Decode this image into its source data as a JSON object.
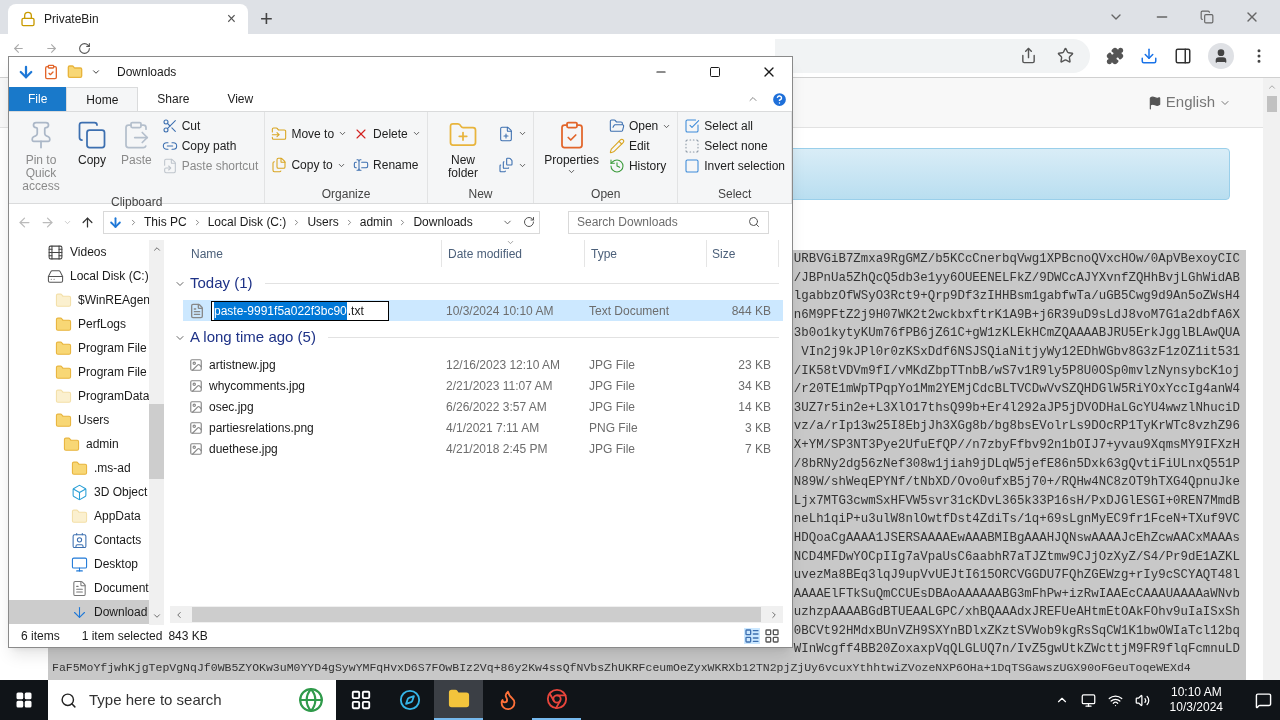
{
  "browser": {
    "tab": {
      "title": "PrivateBin",
      "close": "×"
    },
    "new_tab": "+",
    "language": "English"
  },
  "page": {
    "code_lines": [
      "URBVGiB7Zmxa9RgGMZ/b5KCcCnerbqVwg1XPBcnoQVxcHOw/0ApVBexoyCIC",
      "/JBPnUa5ZhQcQ5db3e1yy6OUEENELFkZ/9DWCcAJYXvnfZQHhBvjLGhWidAB",
      "lgabbzOfWSyO3Rct9+Qrp9Df3zIHHBsm1gabfwTa/uGB5Cwg9d9An5oZWsH4",
      "n6M9PFtZ2j9H07WK2t2wckbxftrK1A9B+j6R39uD9sLdJ8voM7G1a2dbfA6X",
      "3b0o1kytyKUm76fPB6jZ61C+gW1zKLEkHCmZQAAAABJRU5ErkJgglBLAwQUA",
      "VIn2j9kJPl0r0zKSxDdf6NSJSQiaNitjyWy12EDhWGbv8G3zF1zOZ1it531",
      "/IK58tVDVm9fI/vMKdZbpTTnbB/wS7v1R9ly5P8U0OSp0mvlzNynsybcK1oj",
      "/r20TE1mWpTPqpYo1Mm2YEMjCdcBLTVCDwVvSZQHDGlW5RiYOxYccIg4anW4",
      "3UZ7r5in2e+L3XlO17thsQ99b+Er4l292aJP5jDVODHaLGcYU4wwzlNhuciD",
      "vz/a/rIp13w25I8EbjJh3XGg8b/bg8bsEVolrLs9DOcRP1TyKrWTc8vzhZ96",
      "X+YM/SP3NT3Pye2UfuEfQP//n7zbyFfbv92n1bOIJ7+yvau9XqmsMY9IFXzH",
      "/8bRNy2dg56zNef308w1jiah9jDLqW5jefE86n5Dxk63gQvtiFiULnxQ551P",
      "N89W/shWeqEPYNf/tNbXD/Ovo0ufxB5j70+/RQHw4NC8zOT9hTXG4QpnuJke",
      "Ljx7MTG3cwmSxHFVW5svr31cKDvL365k33P16sH/PxDJGlESGI+0REN7MmdB",
      "neLh1qiP+u3ulW8nlOwtfDst4ZdiTs/1q+69sLgnMyEC9fr1FceN+TXuf9VC",
      "HDQoaCgAAAA1JSERSAAAAEwAAABMIBgAAAHJQNswAAAAJcEhZcwAACxMAAAs",
      "NCD4MFDwYOCpIIg7aVpaUsC6aabhR7aTJZtmw9CJjOzXyZ/S4/Pr9dE1AZKL",
      "uvezMa8BEq3lqJ9upVvUEJtI615ORCVGGDU7FQhZGEWzg+rIy9cSCYAQT48l",
      "AAAAElFTkSuQmCCUEsDBAoAAAAAABG3mFhPw+izRwIAAEcCAAAUAAAAaWNvb",
      "uzhzpAAAABGdBTUEAALGPC/xhBQAAAdxJREFUeAHtmEtOAkFOhv9uIaISxSh",
      "0BCVt92HMdxBUnVZH9SXYnBDlxZKztSVWob9kgRsSqCW1K1bwOWIaTcl12bq",
      "WInWcgff4BB20ZoxaxpVqQLGLUQ7n/IvZ5gwUtkZWcttjM9FR9flqFcmnuLD"
    ],
    "last_line": "FaF5MoYfjwhKjgTepVgNqJf0WB5ZYOKw3uM0YYD4gSywYMFqHvxD6S7FOwBIz2Vq+86y2Kw4ssQfNVbsZhUKRFceumOeZyxWKRXb12TN2pjZjUy6vcuxYthhtwiZVozeNXP6OHa+1DqTSGawszUGX90oFGeuToqeWEXd4"
  },
  "explorer": {
    "title": "Downloads",
    "ribbon_tabs": [
      {
        "label": "File",
        "kind": "menu",
        "selected": false
      },
      {
        "label": "Home",
        "kind": "tab",
        "selected": true
      },
      {
        "label": "Share",
        "kind": "tab",
        "selected": false
      },
      {
        "label": "View",
        "kind": "tab",
        "selected": false
      }
    ],
    "ribbon_groups": [
      {
        "label": "Clipboard",
        "columns": [
          [
            {
              "kind": "pin",
              "label": "Pin to Quick access",
              "disabled": true,
              "dropdown": false
            }
          ],
          [
            {
              "kind": "copy",
              "label": "Copy",
              "disabled": false,
              "dropdown": false
            }
          ],
          [
            {
              "kind": "paste",
              "label": "Paste",
              "disabled": true,
              "dropdown": false
            }
          ],
          [
            {
              "kind": "cut",
              "label": "Cut",
              "disabled": false,
              "dropdown": false
            },
            {
              "kind": "copy-path",
              "label": "Copy path",
              "disabled": false,
              "dropdown": false
            },
            {
              "kind": "paste-shortcut",
              "label": "Paste shortcut",
              "disabled": true,
              "dropdown": false
            }
          ]
        ]
      },
      {
        "label": "Organize",
        "columns": [
          [
            {
              "kind": "move",
              "label": "Move to",
              "disabled": false,
              "dropdown": true
            },
            {
              "kind": "copy-to",
              "label": "Copy to",
              "disabled": false,
              "dropdown": true
            }
          ],
          [
            {
              "kind": "delete",
              "label": "Delete",
              "disabled": false,
              "dropdown": true
            },
            {
              "kind": "rename",
              "label": "Rename",
              "disabled": false,
              "dropdown": false
            }
          ]
        ]
      },
      {
        "label": "New",
        "columns": [
          [
            {
              "kind": "new-folder",
              "label": "New folder",
              "disabled": false,
              "dropdown": false
            }
          ],
          [
            {
              "kind": "new-item",
              "disabled": false,
              "dropdown": true
            },
            {
              "kind": "easy-access",
              "disabled": false,
              "dropdown": true
            }
          ]
        ]
      },
      {
        "label": "Open",
        "columns": [
          [
            {
              "kind": "properties",
              "label": "Properties",
              "disabled": false,
              "dropdown": true
            }
          ],
          [
            {
              "kind": "open",
              "label": "Open",
              "disabled": false,
              "dropdown": true
            },
            {
              "kind": "edit",
              "label": "Edit",
              "disabled": false,
              "dropdown": false
            },
            {
              "kind": "history",
              "label": "History",
              "disabled": false,
              "dropdown": false
            }
          ]
        ]
      },
      {
        "label": "Select",
        "columns": [
          [
            {
              "kind": "select-all",
              "label": "Select all",
              "disabled": false,
              "dropdown": false
            },
            {
              "kind": "select-none",
              "label": "Select none",
              "disabled": false,
              "dropdown": false
            },
            {
              "kind": "invert",
              "label": "Invert selection",
              "disabled": false,
              "dropdown": false
            }
          ]
        ]
      }
    ],
    "path": [
      "This PC",
      "Local Disk (C:)",
      "Users",
      "admin",
      "Downloads"
    ],
    "search": {
      "placeholder": "Search Downloads"
    },
    "nav": [
      {
        "label": "Videos",
        "kind": "videos",
        "selected": false
      },
      {
        "label": "Local Disk (C:)",
        "kind": "drive",
        "selected": false,
        "children": [
          {
            "label": "$WinREAgen",
            "kind": "hidden-folder",
            "selected": false
          },
          {
            "label": "PerfLogs",
            "kind": "folder",
            "selected": false
          },
          {
            "label": "Program File",
            "kind": "folder",
            "selected": false
          },
          {
            "label": "Program File",
            "kind": "folder",
            "selected": false
          },
          {
            "label": "ProgramData",
            "kind": "hidden-folder",
            "selected": false
          },
          {
            "label": "Users",
            "kind": "folder",
            "selected": false,
            "children": [
              {
                "label": "admin",
                "kind": "folder",
                "selected": false,
                "children": [
                  {
                    "label": ".ms-ad",
                    "kind": "folder",
                    "selected": false
                  },
                  {
                    "label": "3D Object",
                    "kind": "cube",
                    "selected": false
                  },
                  {
                    "label": "AppData",
                    "kind": "hidden-folder",
                    "selected": false
                  },
                  {
                    "label": "Contacts",
                    "kind": "contacts",
                    "selected": false
                  },
                  {
                    "label": "Desktop",
                    "kind": "desktop",
                    "selected": false
                  },
                  {
                    "label": "Document",
                    "kind": "documents",
                    "selected": false
                  },
                  {
                    "label": "Download",
                    "kind": "downloads",
                    "selected": true
                  }
                ]
              }
            ]
          }
        ]
      }
    ],
    "columns": [
      {
        "label": "Name",
        "sorted": false
      },
      {
        "label": "Date modified",
        "sorted": true
      },
      {
        "label": "Type",
        "sorted": false
      },
      {
        "label": "Size",
        "sorted": false
      }
    ],
    "groups": [
      {
        "label": "Today (1)",
        "expanded": true,
        "files": [
          {
            "kind": "renaming",
            "name_selected": "paste-9991f5a022f3bc90",
            "name_rest": ".txt",
            "date": "10/3/2024 10:10 AM",
            "type": "Text Document",
            "size": "844 KB",
            "selected": true
          }
        ]
      },
      {
        "label": "A long time ago (5)",
        "expanded": true,
        "files": [
          {
            "kind": "file",
            "name": "artistnew.jpg",
            "date": "12/16/2023 12:10 AM",
            "type": "JPG File",
            "size": "23 KB",
            "selected": false
          },
          {
            "kind": "file",
            "name": "whycomments.jpg",
            "date": "2/21/2023 11:07 AM",
            "type": "JPG File",
            "size": "34 KB",
            "selected": false
          },
          {
            "kind": "file",
            "name": "osec.jpg",
            "date": "6/26/2022 3:57 AM",
            "type": "JPG File",
            "size": "14 KB",
            "selected": false
          },
          {
            "kind": "file",
            "name": "partiesrelations.png",
            "date": "4/1/2021 7:11 AM",
            "type": "PNG File",
            "size": "3 KB",
            "selected": false
          },
          {
            "kind": "file",
            "name": "duethese.jpg",
            "date": "4/21/2018 2:45 PM",
            "type": "JPG File",
            "size": "7 KB",
            "selected": false
          }
        ]
      }
    ],
    "status": {
      "count": "6 items",
      "selection": "1 item selected",
      "size": "843 KB"
    }
  },
  "taskbar": {
    "search_placeholder": "Type here to search",
    "apps": [
      {
        "kind": "task-view",
        "active": false,
        "running": false
      },
      {
        "kind": "edge",
        "active": false,
        "running": false
      },
      {
        "kind": "explorer",
        "active": true,
        "running": true
      },
      {
        "kind": "firefox",
        "active": false,
        "running": false
      },
      {
        "kind": "chrome",
        "active": false,
        "running": true
      }
    ],
    "time": "10:10 AM",
    "date": "10/3/2024"
  }
}
